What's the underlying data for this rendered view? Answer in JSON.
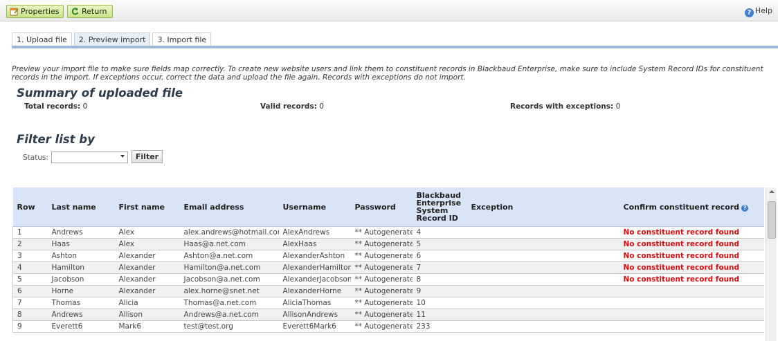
{
  "toolbar": {
    "properties_label": "Properties",
    "return_label": "Return",
    "help_label": "Help"
  },
  "tabs": [
    {
      "label": "1. Upload file"
    },
    {
      "label": "2. Preview import"
    },
    {
      "label": "3. Import file"
    }
  ],
  "intro": "Preview your import file to make sure fields map correctly. To create new website users and link them to constituent records in Blackbaud Enterprise, make sure to include System Record IDs for constituent records in the import. If exceptions occur, correct the data and upload the file again. Records with exceptions do not import.",
  "summary": {
    "title": "Summary of uploaded file",
    "total_label": "Total records:",
    "total_value": "0",
    "valid_label": "Valid records:",
    "valid_value": "0",
    "exceptions_label": "Records with exceptions:",
    "exceptions_value": "0"
  },
  "filter": {
    "title": "Filter list by",
    "status_label": "Status:",
    "status_value": "",
    "button_label": "Filter"
  },
  "table": {
    "headers": {
      "row": "Row",
      "last": "Last name",
      "first": "First name",
      "email": "Email address",
      "username": "Username",
      "password": "Password",
      "sysid_1": "Blackbaud",
      "sysid_2": "Enterprise",
      "sysid_3": "System",
      "sysid_4": "Record ID",
      "exception": "Exception",
      "confirm": "Confirm constituent record"
    },
    "rows": [
      {
        "row": "1",
        "last": "Andrews",
        "first": "Alex",
        "email": "alex.andrews@hotmail.com",
        "username": "AlexAndrews",
        "password": "** Autogenerated **",
        "sysid": "4",
        "exception": "",
        "confirm": "No constituent record found"
      },
      {
        "row": "2",
        "last": "Haas",
        "first": "Alex",
        "email": "Haas@a.net.com",
        "username": "AlexHaas",
        "password": "** Autogenerated **",
        "sysid": "5",
        "exception": "",
        "confirm": "No constituent record found"
      },
      {
        "row": "3",
        "last": "Ashton",
        "first": "Alexander",
        "email": "Ashton@a.net.com",
        "username": "AlexanderAshton",
        "password": "** Autogenerated **",
        "sysid": "6",
        "exception": "",
        "confirm": "No constituent record found"
      },
      {
        "row": "4",
        "last": "Hamilton",
        "first": "Alexander",
        "email": "Hamilton@a.net.com",
        "username": "AlexanderHamilton",
        "password": "** Autogenerated **",
        "sysid": "7",
        "exception": "",
        "confirm": "No constituent record found"
      },
      {
        "row": "5",
        "last": "Jacobson",
        "first": "Alexander",
        "email": "Jacobson@a.net.com",
        "username": "AlexanderJacobson",
        "password": "** Autogenerated **",
        "sysid": "8",
        "exception": "",
        "confirm": "No constituent record found"
      },
      {
        "row": "6",
        "last": "Horne",
        "first": "Alexander",
        "email": "alex.horne@snet.net",
        "username": "AlexanderHorne",
        "password": "** Autogenerated **",
        "sysid": "9",
        "exception": "",
        "confirm": ""
      },
      {
        "row": "7",
        "last": "Thomas",
        "first": "Alicia",
        "email": "Thomas@a.net.com",
        "username": "AliciaThomas",
        "password": "** Autogenerated **",
        "sysid": "10",
        "exception": "",
        "confirm": ""
      },
      {
        "row": "8",
        "last": "Andrews",
        "first": "Allison",
        "email": "Andrews@a.net.com",
        "username": "AllisonAndrews",
        "password": "** Autogenerated **",
        "sysid": "11",
        "exception": "",
        "confirm": ""
      },
      {
        "row": "9",
        "last": "Everett6",
        "first": "Mark6",
        "email": "test@test.org",
        "username": "Everett6Mark6",
        "password": "** Autogenerated **",
        "sysid": "233",
        "exception": "",
        "confirm": ""
      }
    ]
  },
  "colors": {
    "header_bg": "#d7e5f6",
    "warning_text": "#d10f0f",
    "button_green": "#c7e48a"
  }
}
